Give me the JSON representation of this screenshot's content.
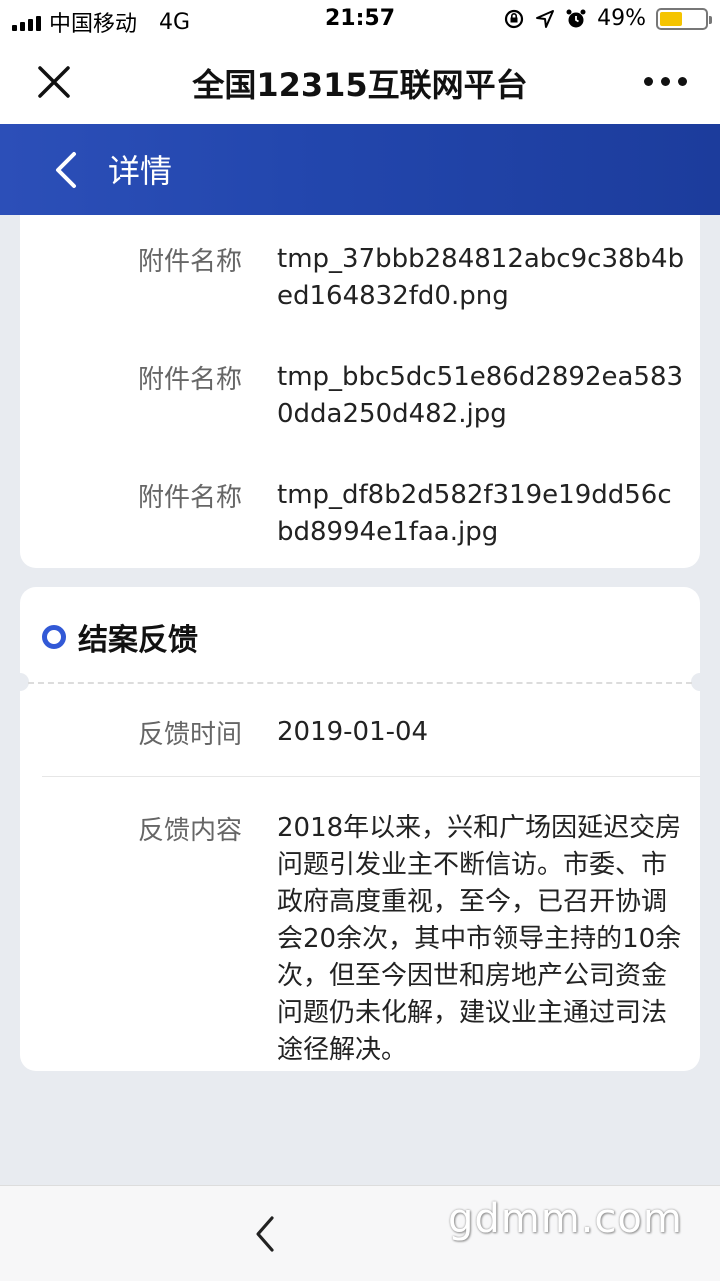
{
  "status_bar": {
    "carrier": "中国移动",
    "network": "4G",
    "time": "21:57",
    "battery_percent": "49%",
    "battery_level": 0.49
  },
  "nav": {
    "title": "全国12315互联网平台"
  },
  "header": {
    "title": "详情"
  },
  "attachments": [
    {
      "label": "附件名称",
      "value": "tmp_37bbb284812abc9c38b4bed164832fd0.png"
    },
    {
      "label": "附件名称",
      "value": "tmp_bbc5dc51e86d2892ea5830dda250d482.jpg"
    },
    {
      "label": "附件名称",
      "value": "tmp_df8b2d582f319e19dd56cbd8994e1faa.jpg"
    }
  ],
  "feedback": {
    "section_title": "结案反馈",
    "time_label": "反馈时间",
    "time_value": "2019-01-04",
    "content_label": "反馈内容",
    "content_value": "2018年以来，兴和广场因延迟交房问题引发业主不断信访。市委、市政府高度重视，至今，已召开协调会20余次，其中市领导主持的10余次，但至今因世和房地产公司资金问题仍未化解，建议业主通过司法途径解决。"
  },
  "watermark": "gdmm.com",
  "colors": {
    "accent": "#3259d6",
    "header_gradient_start": "#2c4fb8",
    "header_gradient_end": "#1c3c9c",
    "battery": "#f5c400"
  }
}
